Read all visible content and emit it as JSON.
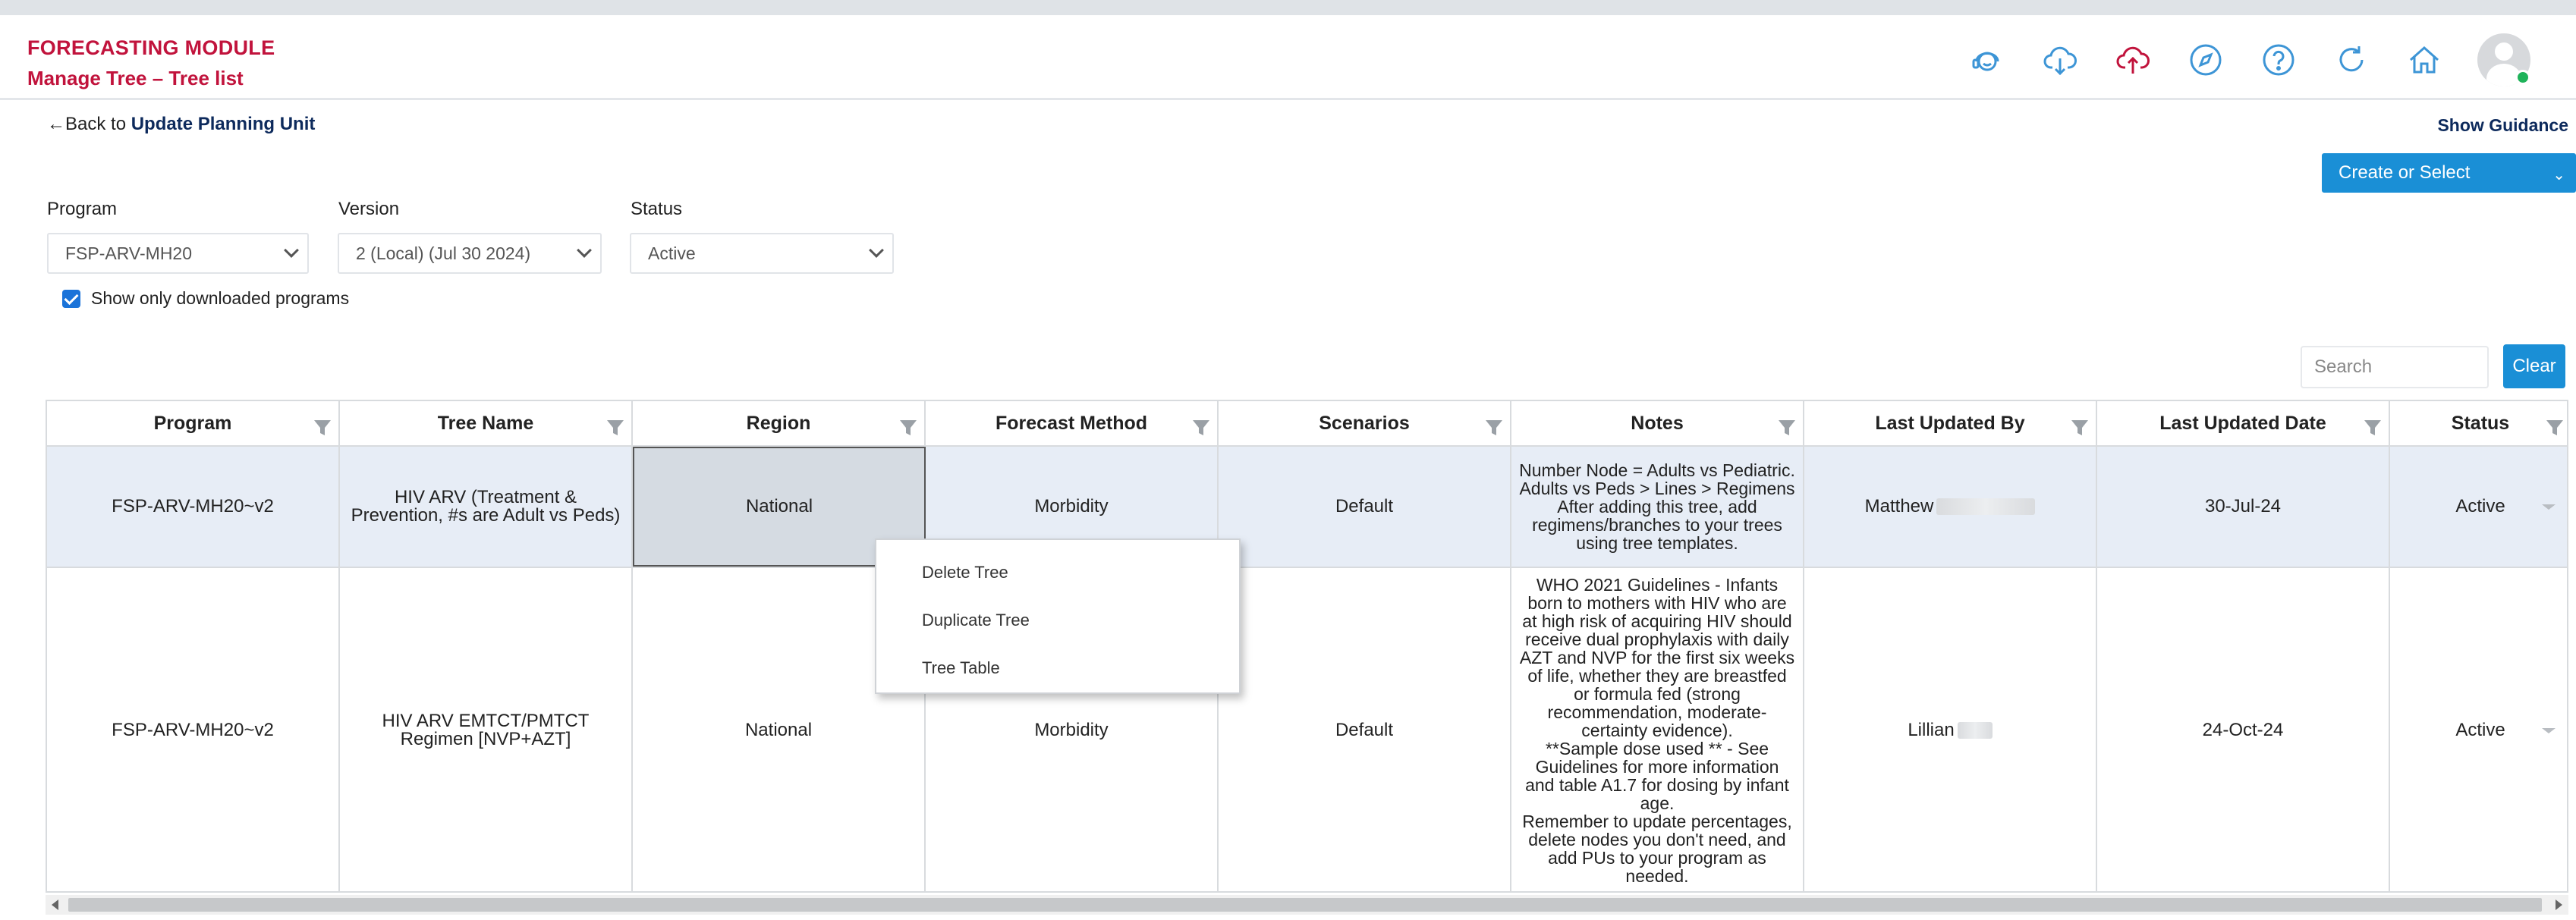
{
  "header": {
    "module_title": "FORECASTING MODULE",
    "page_subtitle": "Manage Tree – Tree list",
    "icons": [
      "support-icon",
      "cloud-download-icon",
      "cloud-upload-icon",
      "compass-icon",
      "help-icon",
      "refresh-icon",
      "home-icon",
      "user-avatar"
    ],
    "accent_color": "#c1133c"
  },
  "nav": {
    "back_arrow": "←",
    "back_prefix": "Back to ",
    "back_target": "Update Planning Unit",
    "show_guidance": "Show Guidance",
    "create_or_select": "Create or Select"
  },
  "filters": {
    "program_label": "Program",
    "program_value": "FSP-ARV-MH20",
    "version_label": "Version",
    "version_value": "2 (Local) (Jul 30 2024)",
    "status_label": "Status",
    "status_value": "Active",
    "show_downloaded_label": "Show only downloaded programs",
    "show_downloaded_checked": true
  },
  "search": {
    "placeholder": "Search",
    "clear_label": "Clear"
  },
  "table": {
    "columns": [
      "Program",
      "Tree Name",
      "Region",
      "Forecast Method",
      "Scenarios",
      "Notes",
      "Last Updated By",
      "Last Updated Date",
      "Status"
    ],
    "rows": [
      {
        "program": "FSP-ARV-MH20~v2",
        "tree_name": "HIV ARV (Treatment & Prevention, #s are Adult vs Peds)",
        "region": "National",
        "forecast_method": "Morbidity",
        "scenarios": "Default",
        "notes": "Number Node = Adults vs Pediatric.  Adults vs Peds > Lines > Regimens\nAfter adding this tree, add regimens/branches to your trees using tree templates.",
        "last_updated_by": "Matthew",
        "last_updated_date": "30-Jul-24",
        "status": "Active"
      },
      {
        "program": "FSP-ARV-MH20~v2",
        "tree_name": "HIV ARV EMTCT/PMTCT Regimen [NVP+AZT]",
        "region": "National",
        "forecast_method": "Morbidity",
        "scenarios": "Default",
        "notes": "WHO 2021 Guidelines - Infants born to mothers with HIV who are at high risk of acquiring HIV should receive dual prophylaxis with daily AZT and NVP for the first six weeks of life, whether they are breastfed or formula fed (strong recommendation, moderate-certainty evidence).\n**Sample dose used ** - See Guidelines for more information and table A1.7 for dosing by infant age.\nRemember to update percentages, delete nodes you don't need, and add PUs to your program as needed.",
        "last_updated_by": "Lillian",
        "last_updated_date": "24-Oct-24",
        "status": "Active"
      }
    ]
  },
  "context_menu": {
    "items": [
      "Delete Tree",
      "Duplicate Tree",
      "Tree Table"
    ]
  }
}
